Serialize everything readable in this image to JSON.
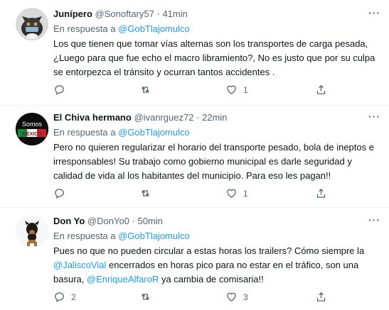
{
  "tweets": [
    {
      "name": "Junípero",
      "handle": "@Sonoftary57",
      "time": "41min",
      "reply_prefix": "En respuesta a",
      "reply_to": "@GobTlajomulco",
      "body": "Los que tienen que tomar vías alternas son los transportes de carga pesada,¿Luego para que fue echo el macro libramiento?, No es justo que por su culpa se entorpezca el tránsito y ocurran tantos accidentes .",
      "replies": "",
      "retweets": "",
      "likes": "1"
    },
    {
      "name": "El Chiva hermano",
      "handle": "@ivanrguez72",
      "time": "22min",
      "avatar_text_top": "Somos",
      "avatar_text_bottom": "MÉXICO",
      "reply_prefix": "En respuesta a",
      "reply_to": "@GobTlajomulco",
      "body": "Pero no quieren regularizar el horario del transporte pesado, bola de ineptos e irresponsables! Su trabajo como gobierno municipal es darle seguridad y calidad de vida al los habitantes del municipio. Para eso les pagan!!",
      "replies": "",
      "retweets": "",
      "likes": "1"
    },
    {
      "name": "Don Yo",
      "handle": "@DonYo0",
      "time": "50min",
      "reply_prefix": "En respuesta a",
      "reply_to": "@GobTlajomulco",
      "body_part1": "Pues no que no pueden circular a estas horas los trailers? Cómo siempre la ",
      "mention1": "@JaliscoVial",
      "body_part2": " encerrados en horas pico para no estar en el tráfico, son una basura, ",
      "mention2": "@EnriqueAlfaroR",
      "body_part3": " ya cambia de comisaria!!",
      "replies": "2",
      "retweets": "",
      "likes": "3"
    }
  ],
  "colors": {
    "accent": "#1d9bf0",
    "muted": "#536471",
    "text": "#0f1419",
    "divider": "#eff3f4"
  },
  "icons": {
    "reply": "reply-icon",
    "retweet": "retweet-icon",
    "like": "heart-icon",
    "share": "share-icon",
    "more": "more-icon"
  }
}
